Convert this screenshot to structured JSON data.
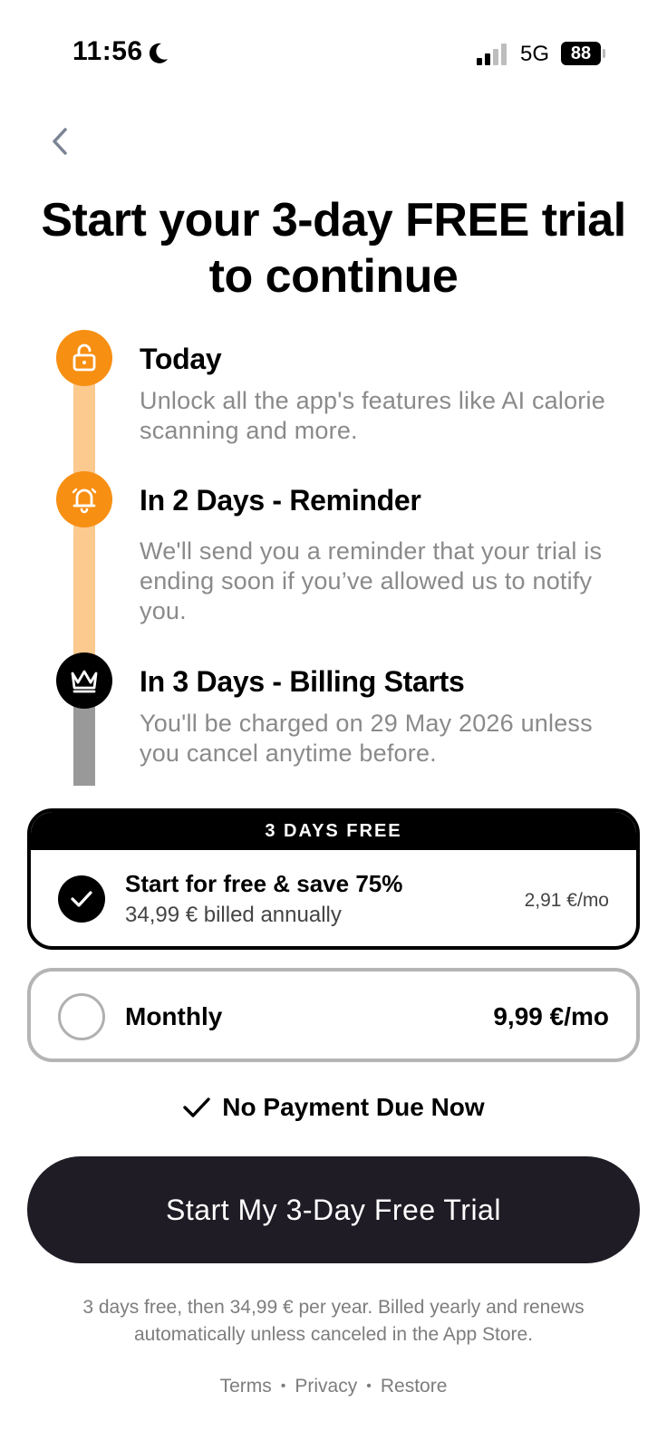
{
  "status_bar": {
    "time": "11:56",
    "network": "5G",
    "battery": "88",
    "icons": [
      "moon-icon",
      "signal-icon"
    ]
  },
  "nav": {
    "back_icon": "chevron-left-icon"
  },
  "headline": "Start your 3-day FREE trial to continue",
  "timeline": [
    {
      "icon": "unlock-icon",
      "color": "#f78f12",
      "title": "Today",
      "description": "Unlock all the app's features like AI calorie scanning and more."
    },
    {
      "icon": "bell-icon",
      "color": "#f78f12",
      "title": "In 2 Days - Reminder",
      "description": "We'll send you a reminder that your trial is ending soon if you’ve allowed us to notify you."
    },
    {
      "icon": "crown-icon",
      "color": "#000000",
      "title": "In 3 Days - Billing Starts",
      "description": "You'll be charged on 29 May 2026 unless you cancel anytime before."
    }
  ],
  "plans": {
    "annual": {
      "badge": "3 DAYS FREE",
      "title": "Start for free & save 75%",
      "subtitle": "34,99 € billed annually",
      "price": "2,91 €/mo",
      "selected": true
    },
    "monthly": {
      "title": "Monthly",
      "price": "9,99 €/mo",
      "selected": false
    }
  },
  "no_payment": "No Payment Due Now",
  "cta": "Start My 3-Day Free Trial",
  "disclaimer": "3 days free, then 34,99 € per year. Billed yearly and renews automatically unless canceled in the App Store.",
  "footer": {
    "terms": "Terms",
    "privacy": "Privacy",
    "restore": "Restore",
    "separator": "•"
  },
  "colors": {
    "accent": "#f78f12",
    "track_active": "#fcc98f",
    "track_inactive": "#999999",
    "cta_bg": "#1f1c25"
  }
}
